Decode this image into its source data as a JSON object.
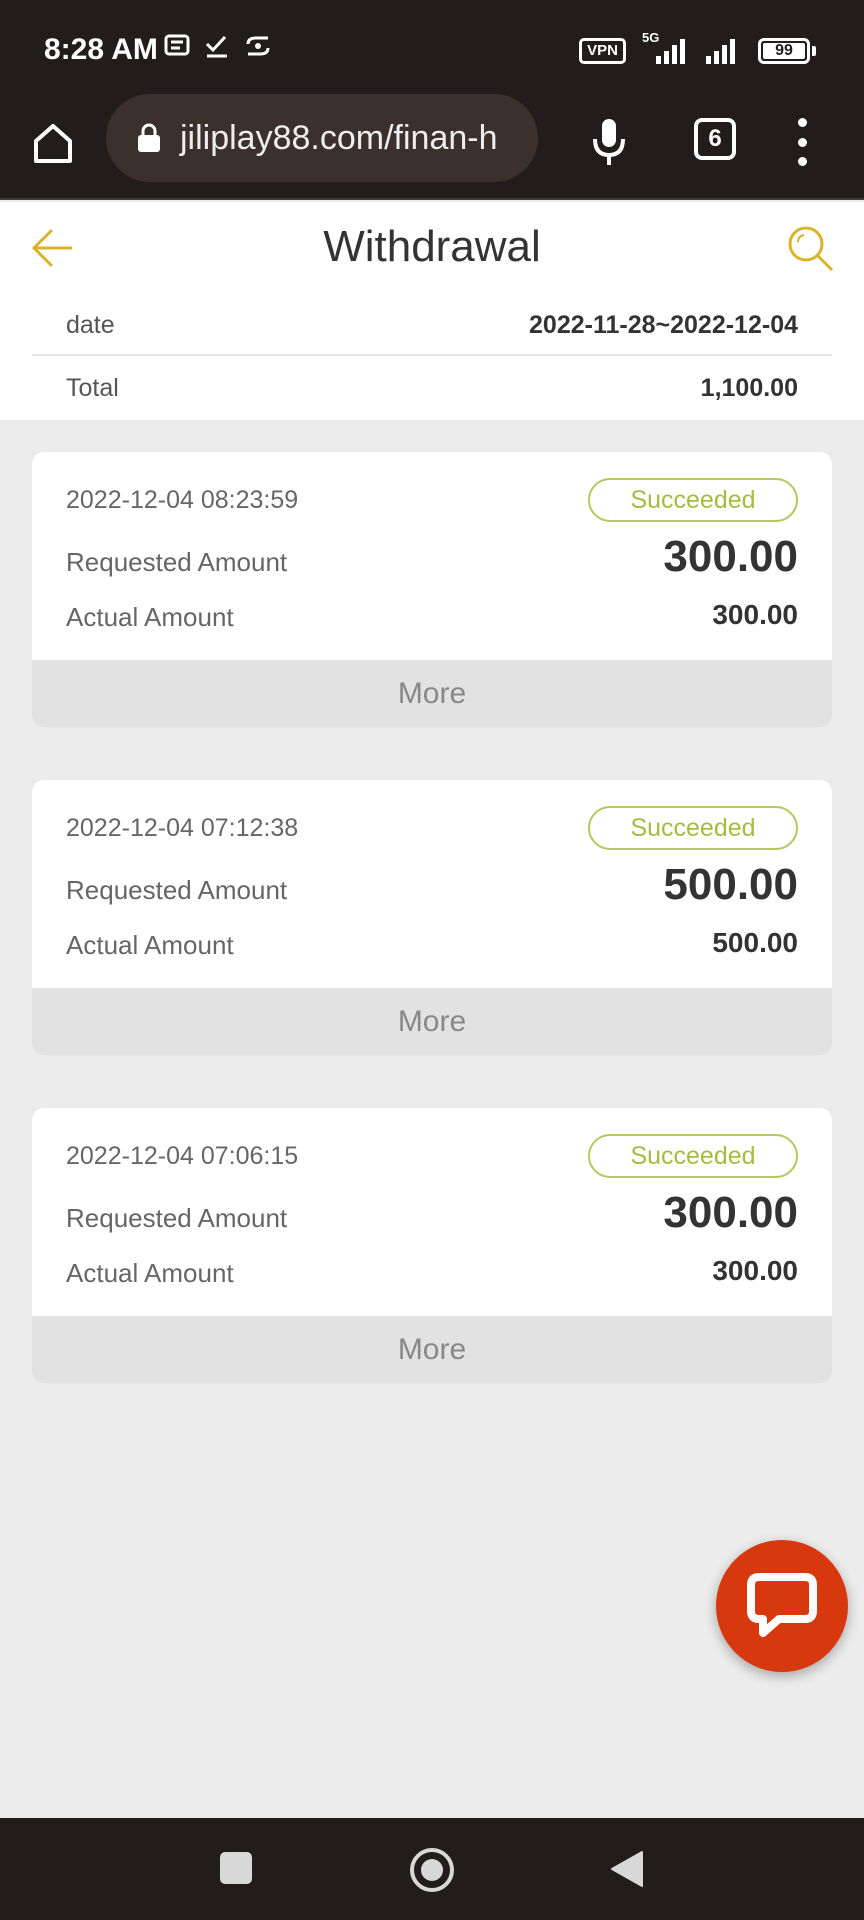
{
  "status_bar": {
    "time": "8:28 AM",
    "vpn": "VPN",
    "network": "5G",
    "battery": "99"
  },
  "browser": {
    "url": "jiliplay88.com/finan-h",
    "tab_count": "6"
  },
  "page": {
    "title": "Withdrawal"
  },
  "summary": {
    "date_label": "date",
    "date_value": "2022-11-28~2022-12-04",
    "total_label": "Total",
    "total_value": "1,100.00"
  },
  "records": [
    {
      "datetime": "2022-12-04 08:23:59",
      "status": "Succeeded",
      "requested_label": "Requested Amount",
      "requested_amount": "300.00",
      "actual_label": "Actual Amount",
      "actual_amount": "300.00",
      "more_label": "More"
    },
    {
      "datetime": "2022-12-04 07:12:38",
      "status": "Succeeded",
      "requested_label": "Requested Amount",
      "requested_amount": "500.00",
      "actual_label": "Actual Amount",
      "actual_amount": "500.00",
      "more_label": "More"
    },
    {
      "datetime": "2022-12-04 07:06:15",
      "status": "Succeeded",
      "requested_label": "Requested Amount",
      "requested_amount": "300.00",
      "actual_label": "Actual Amount",
      "actual_amount": "300.00",
      "more_label": "More"
    }
  ],
  "colors": {
    "accent": "#d9b32b",
    "status_green": "#a7bb3e",
    "chat_button": "#d8380e",
    "system_bar": "#231c1c"
  },
  "icons": {
    "back": "arrow-left-icon",
    "search": "search-icon",
    "chat": "chat-bubble-icon"
  }
}
